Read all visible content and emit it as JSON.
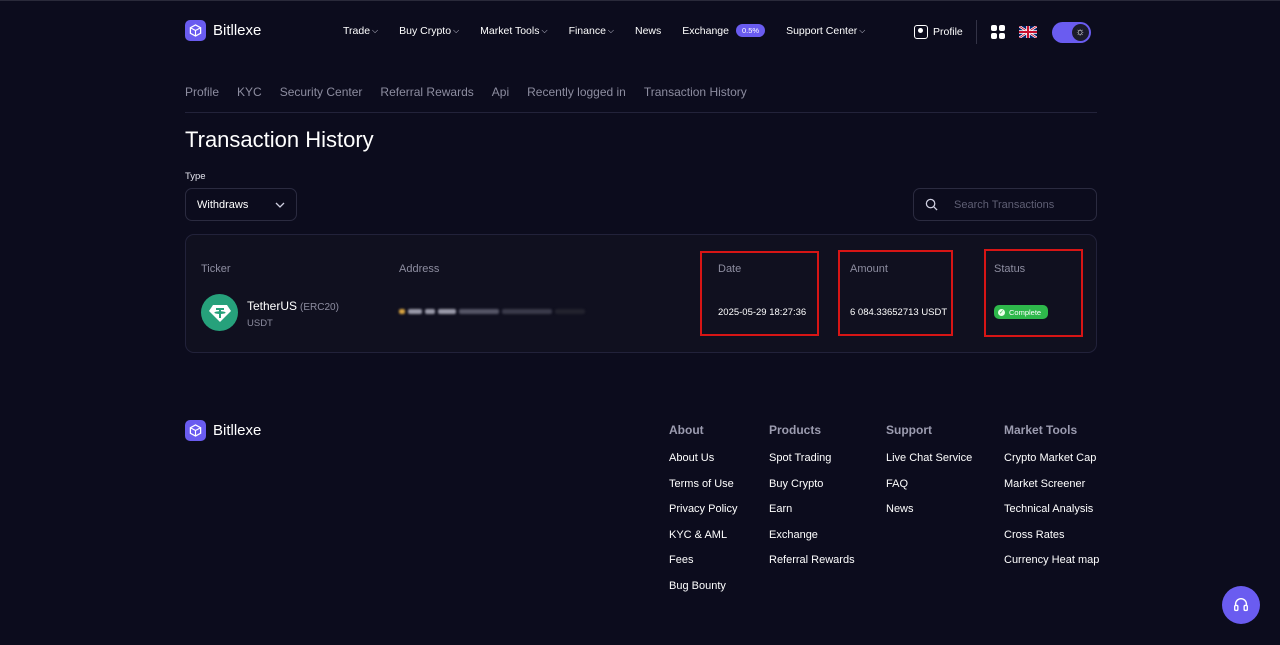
{
  "brand": {
    "name": "Bitllexe"
  },
  "nav": {
    "items": [
      {
        "label": "Trade",
        "has_caret": true
      },
      {
        "label": "Buy Crypto",
        "has_caret": true
      },
      {
        "label": "Market Tools",
        "has_caret": true
      },
      {
        "label": "Finance",
        "has_caret": true
      },
      {
        "label": "News",
        "has_caret": false
      },
      {
        "label": "Exchange",
        "has_caret": false,
        "badge": "0.5%"
      },
      {
        "label": "Support Center",
        "has_caret": true
      }
    ],
    "profile_label": "Profile"
  },
  "subnav": {
    "items": [
      "Profile",
      "KYC",
      "Security Center",
      "Referral Rewards",
      "Api",
      "Recently logged in",
      "Transaction History"
    ]
  },
  "page": {
    "title": "Transaction History",
    "type_label": "Type",
    "type_value": "Withdraws",
    "search_placeholder": "Search Transactions"
  },
  "table": {
    "headers": {
      "ticker": "Ticker",
      "address": "Address",
      "date": "Date",
      "amount": "Amount",
      "status": "Status"
    },
    "rows": [
      {
        "ticker_name": "TetherUS",
        "ticker_network": "(ERC20)",
        "ticker_symbol": "USDT",
        "date": "2025-05-29 18:27:36",
        "amount": "6 084.33652713 USDT",
        "status": "Complete"
      }
    ]
  },
  "footer": {
    "columns": [
      {
        "title": "About",
        "links": [
          "About Us",
          "Terms of Use",
          "Privacy Policy",
          "KYC & AML",
          "Fees",
          "Bug Bounty"
        ]
      },
      {
        "title": "Products",
        "links": [
          "Spot Trading",
          "Buy Crypto",
          "Earn",
          "Exchange",
          "Referral Rewards"
        ]
      },
      {
        "title": "Support",
        "links": [
          "Live Chat Service",
          "FAQ",
          "News"
        ]
      },
      {
        "title": "Market Tools",
        "links": [
          "Crypto Market Cap",
          "Market Screener",
          "Technical Analysis",
          "Cross Rates",
          "Currency Heat map"
        ]
      }
    ]
  },
  "colors": {
    "background": "#0c0c1d",
    "accent": "#6a5cf0",
    "status_complete": "#2eb84b",
    "highlight_box": "#d71515",
    "tether": "#26a17b"
  },
  "icons": {
    "brand": "cube-logo-icon",
    "profile": "user-square-icon",
    "apps": "grid-icon",
    "language": "uk-flag-icon",
    "theme": "sun-icon",
    "search": "search-icon",
    "type_select": "chevron-down-icon",
    "ticker": "tether-icon",
    "status": "check-circle-icon",
    "chat": "headset-icon"
  }
}
